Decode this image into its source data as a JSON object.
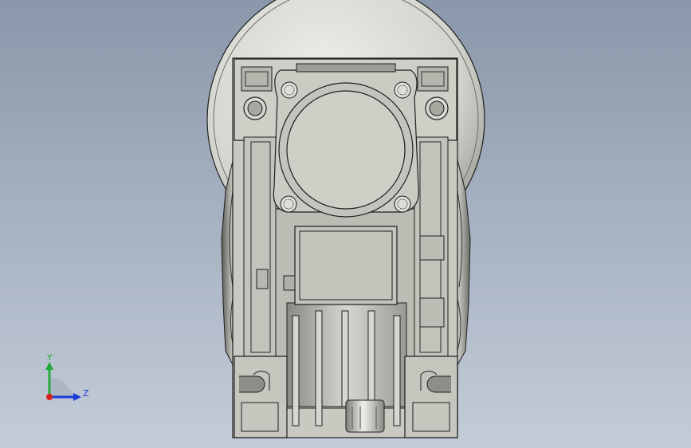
{
  "viewport": {
    "colors": {
      "background_top": "#8a97aa",
      "background_bottom": "#c3ccd8",
      "part_face": "#c8c8c0",
      "part_shadow": "#8e8e88",
      "edge": "#1e1e1e"
    }
  },
  "triad": {
    "x_axis_label": "Z",
    "y_axis_label": "Y",
    "colors": {
      "z": "#1b3cd8",
      "y": "#22a83a",
      "origin": "#d82020"
    }
  }
}
